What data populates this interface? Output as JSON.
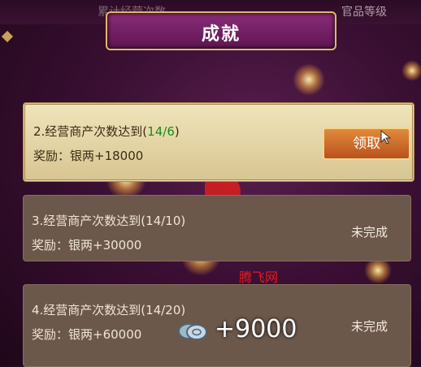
{
  "top_tabs": {
    "left": "累计经营次数",
    "right": "官品等级"
  },
  "title": "成就",
  "achievements": [
    {
      "title": "2.经营商产次数达到(",
      "progress": "14/6",
      "title_end": ")",
      "reward": "奖励：银两+18000",
      "action": "领取"
    },
    {
      "title": "3.经营商产次数达到(14/10)",
      "reward": "奖励：银两+30000",
      "status": "未完成"
    },
    {
      "title": "4.经营商产次数达到(14/20)",
      "reward": "奖励：银两+60000",
      "status": "未完成"
    }
  ],
  "reward_popup": {
    "amount": "+9000",
    "icon": "silver-coins-icon"
  },
  "watermark": "腾飞网",
  "colors": {
    "progress_done": "#1a8a1a",
    "claim_button": "#d0702c",
    "banner": "#7a2468"
  }
}
